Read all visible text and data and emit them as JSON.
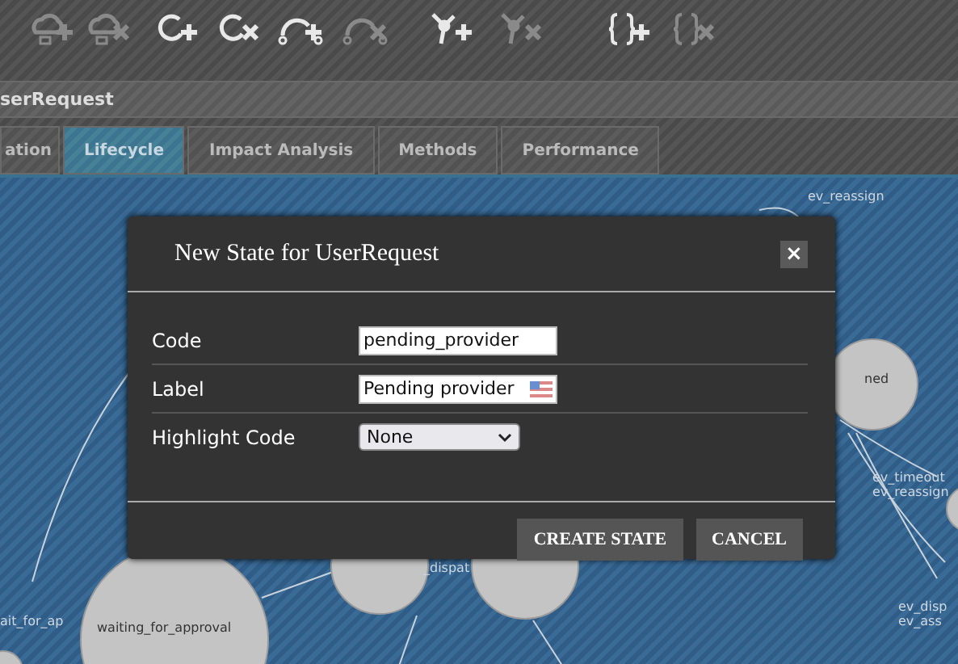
{
  "toolbar": [
    {
      "kind": "cloud-add",
      "disabled": true
    },
    {
      "kind": "cloud-remove",
      "disabled": true
    },
    {
      "kind": "state-add",
      "disabled": false
    },
    {
      "kind": "state-remove",
      "disabled": false
    },
    {
      "kind": "transition-add",
      "disabled": false
    },
    {
      "kind": "transition-remove",
      "disabled": true
    },
    {
      "kind": "node-add",
      "disabled": false
    },
    {
      "kind": "node-remove",
      "disabled": true
    },
    {
      "kind": "braces-add",
      "disabled": false
    },
    {
      "kind": "braces-remove",
      "disabled": true
    }
  ],
  "title": "serRequest",
  "tabs": [
    {
      "label": "ation",
      "selected": false
    },
    {
      "label": "Lifecycle",
      "selected": true
    },
    {
      "label": "Impact Analysis",
      "selected": false
    },
    {
      "label": "Methods",
      "selected": false
    },
    {
      "label": "Performance",
      "selected": false
    }
  ],
  "diagram": {
    "labels": [
      "ev_reassign",
      "ned",
      "ev_timeout",
      "ev_reassign",
      "ev_disp",
      "ev_ass",
      "_dispat",
      "ait_for_ap",
      "waiting_for_approval"
    ]
  },
  "dialog": {
    "title": "New State for UserRequest",
    "close": "×",
    "fields": [
      {
        "kind": "text",
        "label": "Code",
        "value": "pending_provider"
      },
      {
        "kind": "localized",
        "label": "Label",
        "value": "Pending provider"
      },
      {
        "kind": "select",
        "label": "Highlight Code",
        "value": "None"
      }
    ],
    "buttons": [
      "CREATE STATE",
      "CANCEL"
    ]
  }
}
